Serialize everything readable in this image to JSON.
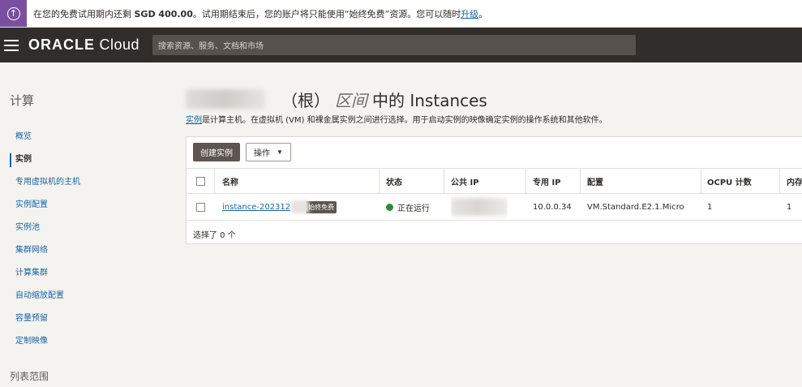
{
  "banner": {
    "icon": "arrow-up-circle-icon",
    "text_before": "在您的免费试用期内还剩 ",
    "amount": "SGD 400.00",
    "text_after": "。试用期结束后，您的账户将只能使用“始终免费”资源。您可以随时",
    "link": "升级",
    "end": "。"
  },
  "header": {
    "menu_icon": "hamburger-menu-icon",
    "logo_brand": "ORACLE",
    "logo_product": " Cloud",
    "search_placeholder": "搜索资源、服务、文档和市场"
  },
  "sidebar": {
    "title": "计算",
    "items": [
      {
        "label": "概览"
      },
      {
        "label": "实例"
      },
      {
        "label": "专用虚拟机的主机"
      },
      {
        "label": "实例配置"
      },
      {
        "label": "实例池"
      },
      {
        "label": "集群网络"
      },
      {
        "label": "计算集群"
      },
      {
        "label": "自动缩放配置"
      },
      {
        "label": "容量预留"
      },
      {
        "label": "定制映像"
      }
    ],
    "scope_label": "列表范围"
  },
  "main": {
    "title_paren": "（根）",
    "title_compartment": "区间",
    "title_suffix": "中的 Instances",
    "desc_link": "实例",
    "desc_text": "是计算主机。在虚拟机 (VM) 和裸金属实例之间进行选择。用于启动实例的映像确定实例的操作系统和其他软件。",
    "create_button": "创建实例",
    "actions_button": "操作",
    "columns": [
      "名称",
      "状态",
      "公共 IP",
      "专用 IP",
      "配置",
      "OCPU 计数",
      "内存"
    ],
    "rows": [
      {
        "name": "instance-202312",
        "badge": "始终免费",
        "status": "正在运行",
        "status_color": "#2e8b3e",
        "private_ip": "10.0.0.34",
        "shape": "VM.Standard.E2.1.Micro",
        "ocpu": "1",
        "memory": "1"
      }
    ],
    "selected_text": "选择了 0 个"
  },
  "colors": {
    "banner_icon_bg": "#7b4fa0",
    "topbar_bg": "#312d2a",
    "link": "#1a64a3"
  }
}
